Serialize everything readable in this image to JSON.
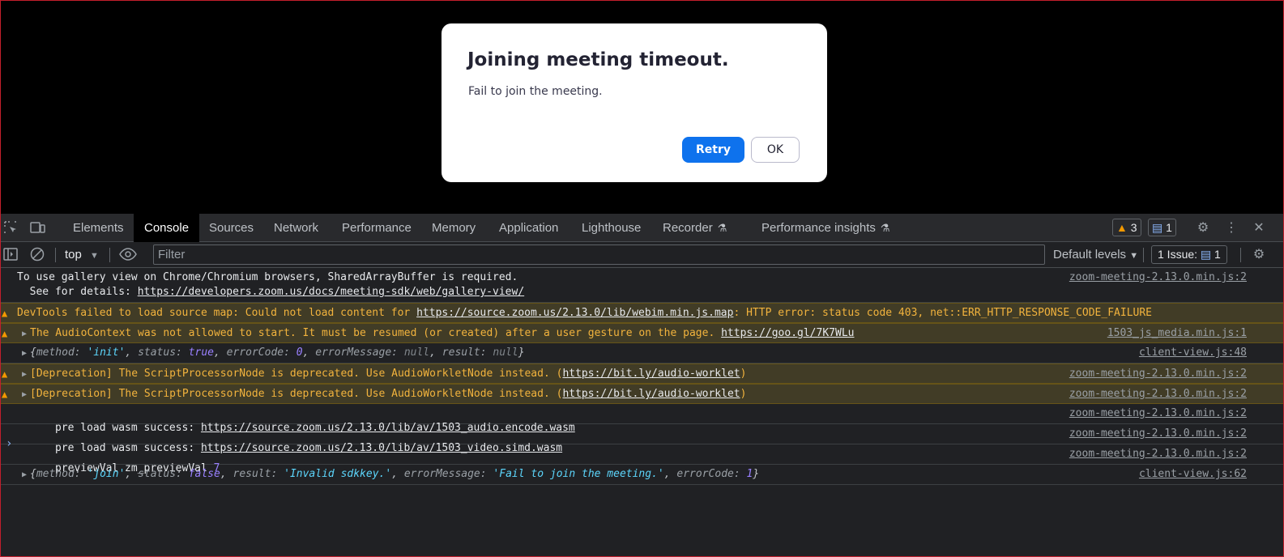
{
  "modal": {
    "title": "Joining meeting timeout.",
    "message": "Fail to join the meeting.",
    "retry_label": "Retry",
    "ok_label": "OK"
  },
  "devtools": {
    "tabs": [
      "Elements",
      "Console",
      "Sources",
      "Network",
      "Performance",
      "Memory",
      "Application",
      "Lighthouse",
      "Recorder",
      "Performance insights"
    ],
    "active_tab": "Console",
    "warnings_count": "3",
    "messages_count": "1",
    "context": "top",
    "filter_placeholder": "Filter",
    "levels_label": "Default levels",
    "issues_label": "1 Issue:",
    "issues_count": "1"
  },
  "console": {
    "r1_text": "To use gallery view on Chrome/Chromium browsers, SharedArrayBuffer is required.",
    "r1_text2": "  See for details: ",
    "r1_link": "https://developers.zoom.us/docs/meeting-sdk/web/gallery-view/",
    "r1_src": "zoom-meeting-2.13.0.min.js:2",
    "r2_text": "DevTools failed to load source map: Could not load content for ",
    "r2_link": "https://source.zoom.us/2.13.0/lib/webim.min.js.map",
    "r2_text2": ": HTTP error: status code 403, net::ERR_HTTP_RESPONSE_CODE_FAILURE",
    "r3_text": "The AudioContext was not allowed to start. It must be resumed (or created) after a user gesture on the page. ",
    "r3_link": "https://goo.gl/7K7WLu",
    "r3_src": "1503_js_media.min.js:1",
    "r4_src": "client-view.js:48",
    "r5_text": "[Deprecation] The ScriptProcessorNode is deprecated. Use AudioWorkletNode instead. (",
    "r5_link": "https://bit.ly/audio-worklet",
    "r5_text2": ")",
    "r5_src": "zoom-meeting-2.13.0.min.js:2",
    "r7_text": "pre load wasm success: ",
    "r7_link": "https://source.zoom.us/2.13.0/lib/av/1503_audio.encode.wasm",
    "r8_link": "https://source.zoom.us/2.13.0/lib/av/1503_video.simd.wasm",
    "r9_text": "previewVal zm_previewVal ",
    "r9_num": "7",
    "r10_src": "client-view.js:62",
    "obj": {
      "open": "{",
      "close": "}",
      "comma": ", ",
      "k_method": "method: ",
      "k_status": "status: ",
      "k_errorCode": "errorCode: ",
      "k_errorMessage": "errorMessage: ",
      "k_result": "result: ",
      "v_init": "'init'",
      "v_true": "true",
      "v_zero": "0",
      "v_null": "null",
      "v_join": "'join'",
      "v_false": "false",
      "v_invalid": "'Invalid sdkkey.'",
      "v_fail": "'Fail to join the meeting.'",
      "v_one": "1"
    },
    "prompt": "›"
  }
}
